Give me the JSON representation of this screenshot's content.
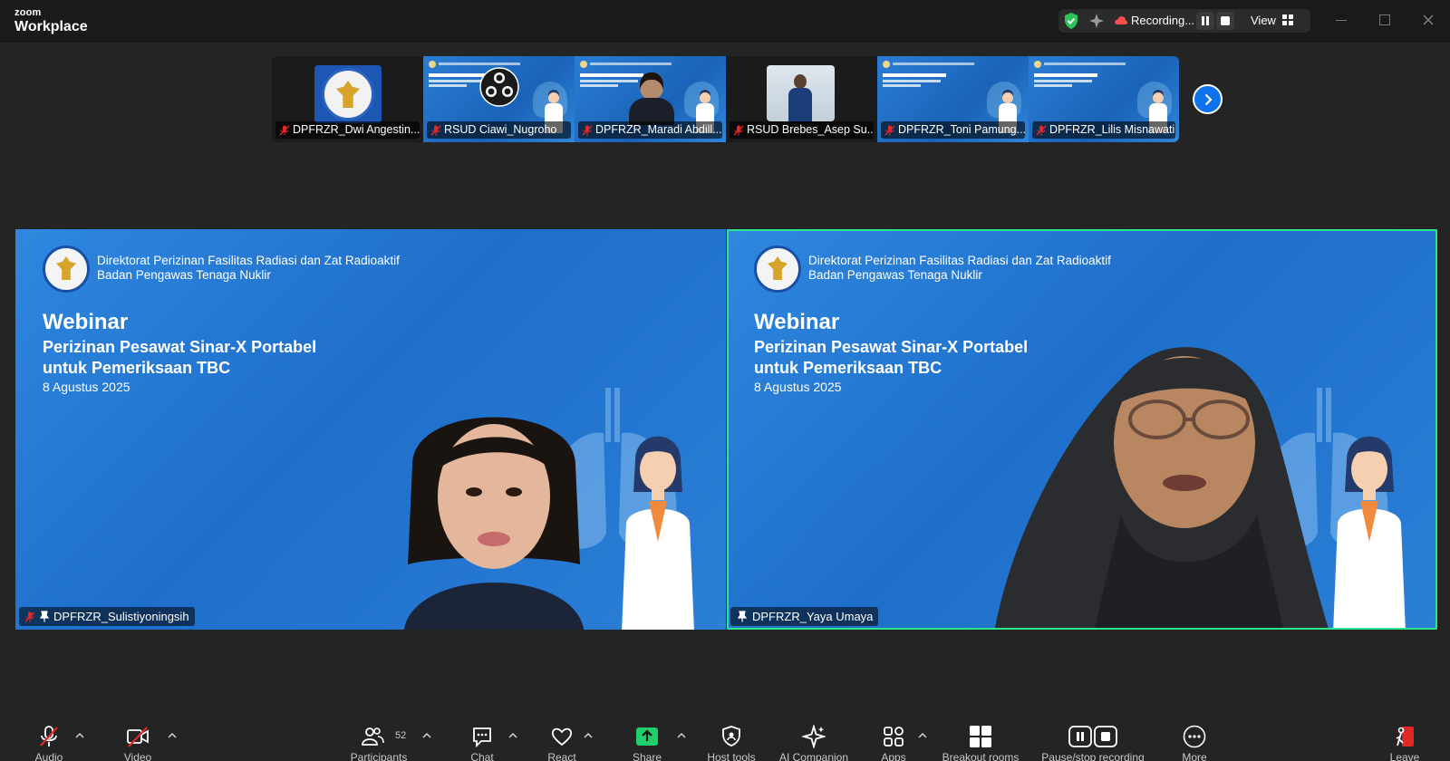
{
  "app": {
    "brand_small": "zoom",
    "brand_large": "Workplace"
  },
  "titlebar": {
    "recording_label": "Recording...",
    "view_label": "View"
  },
  "thumbnails": [
    {
      "name": "DPFRZR_Dwi Angestin...",
      "muted": true,
      "kind": "logo"
    },
    {
      "name": "RSUD Ciawi_Nugroho",
      "muted": true,
      "kind": "slide-obs"
    },
    {
      "name": "DPFRZR_Maradi Abdill...",
      "muted": true,
      "kind": "slide-person"
    },
    {
      "name": "RSUD Brebes_Asep Su...",
      "muted": true,
      "kind": "photo"
    },
    {
      "name": "DPFRZR_Toni Pamung...",
      "muted": true,
      "kind": "slide"
    },
    {
      "name": "DPFRZR_Lilis Misnawati",
      "muted": true,
      "kind": "slide"
    }
  ],
  "slide": {
    "org_line1": "Direktorat Perizinan Fasilitas Radiasi dan Zat Radioaktif",
    "org_line2": "Badan Pengawas Tenaga Nuklir",
    "title": "Webinar",
    "subtitle_line1": "Perizinan Pesawat Sinar-X Portabel",
    "subtitle_line2": "untuk Pemeriksaan TBC",
    "date": "8 Agustus 2025"
  },
  "panes": [
    {
      "name": "DPFRZR_Sulistiyoningsih",
      "muted": true,
      "pinned": true,
      "active": false
    },
    {
      "name": "DPFRZR_Yaya Umaya",
      "muted": false,
      "pinned": true,
      "active": true
    }
  ],
  "toolbar": {
    "audio": "Audio",
    "video": "Video",
    "participants": "Participants",
    "participants_count": "52",
    "chat": "Chat",
    "react": "React",
    "share": "Share",
    "host_tools": "Host tools",
    "ai_companion": "AI Companion",
    "apps": "Apps",
    "breakout_rooms": "Breakout rooms",
    "pause_stop_recording": "Pause/stop recording",
    "more": "More",
    "leave": "Leave"
  },
  "colors": {
    "accent_blue": "#0e72ed",
    "active_speaker": "#2ee58f",
    "muted_red": "#e02828",
    "share_green": "#1fcf6a",
    "slide_blue": "#1e6fcb"
  }
}
